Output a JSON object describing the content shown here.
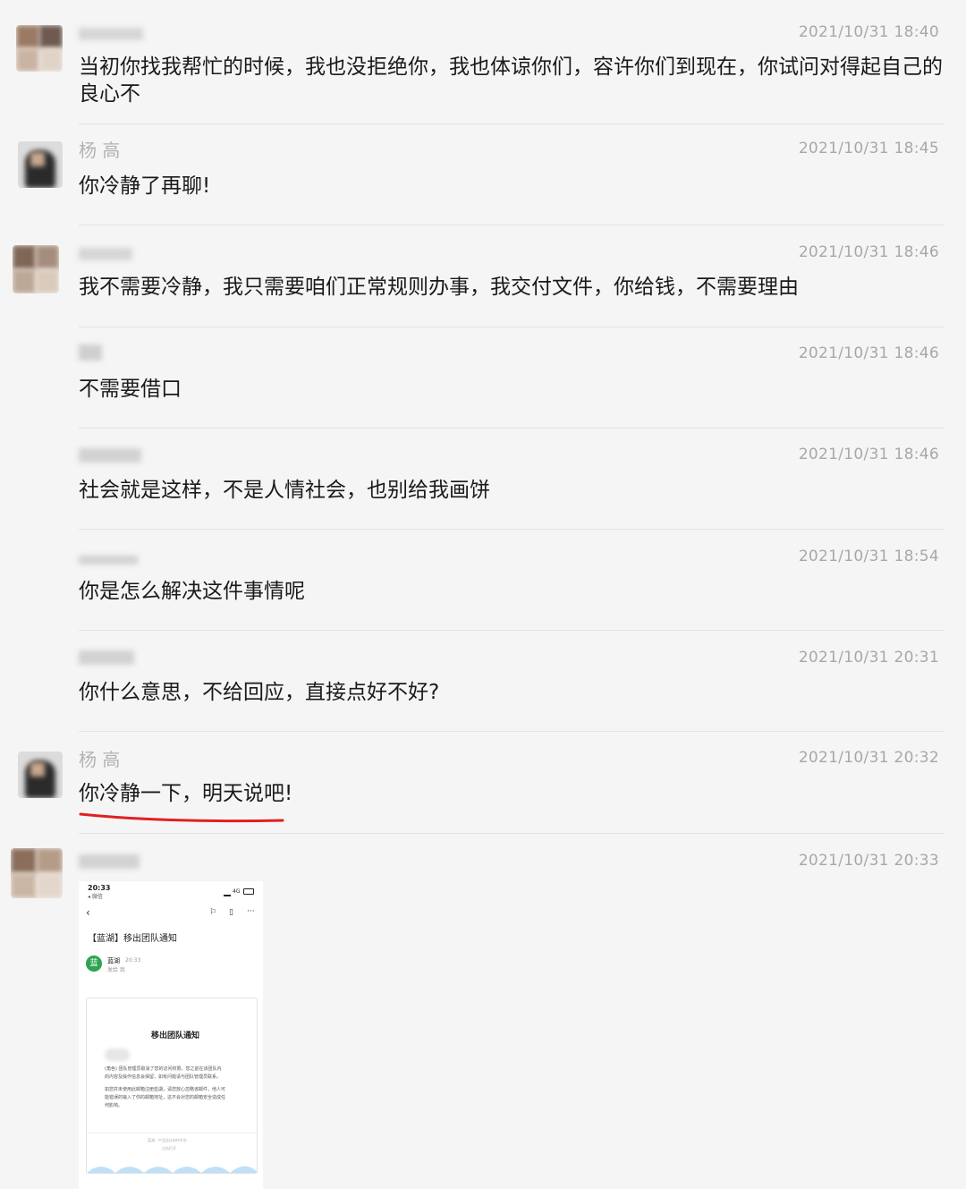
{
  "messages": [
    {
      "name": "",
      "time": "2021/10/31 18:40",
      "text": "当初你找我帮忙的时候，我也没拒绝你，我也体谅你们，容许你们到现在，你试问对得起自己的良心不"
    },
    {
      "name": "杨  高",
      "time": "2021/10/31 18:45",
      "text": "你冷静了再聊!"
    },
    {
      "name": "",
      "time": "2021/10/31 18:46",
      "text": "我不需要冷静，我只需要咱们正常规则办事，我交付文件，你给钱，不需要理由"
    },
    {
      "name": "",
      "time": "2021/10/31 18:46",
      "text": "不需要借口"
    },
    {
      "name": "",
      "time": "2021/10/31 18:46",
      "text": "社会就是这样，不是人情社会，也别给我画饼"
    },
    {
      "name": "",
      "time": "2021/10/31 18:54",
      "text": "你是怎么解决这件事情呢"
    },
    {
      "name": "",
      "time": "2021/10/31 20:31",
      "text": "你什么意思，不给回应，直接点好不好?"
    },
    {
      "name": "杨  高",
      "time": "2021/10/31 20:32",
      "text": "你冷静一下，明天说吧!"
    },
    {
      "name": "",
      "time": "2021/10/31 20:33",
      "text": ""
    }
  ],
  "screenshot": {
    "status_time": "20:33",
    "back_app": "◂ 微信",
    "network": "4G",
    "email_subject": "【蓝湖】移出团队通知",
    "sender_avatar": "蓝",
    "sender": "蓝湖",
    "sender_time": "20:33",
    "recipient": "发给 我",
    "card_title": "移出团队通知",
    "body_line_1": "(角色) 团队管理员取消了您的访问权限。您之前在该团队内",
    "body_line_2": "的内容及操作信息会保留，如有问题请与团队管理员联系。",
    "body_line_3": "如您并未使用此邮箱注册蓝湖，请您放心忽略该邮件，他人可",
    "body_line_4": "能错误的输入了你的邮箱地址，这不会对您的邮箱安全造成任",
    "body_line_5": "何影响。",
    "footer_1": "蓝湖 · 产品设计协作平台",
    "footer_2": "点击打开"
  },
  "colors": {
    "underline": "#e02020",
    "brand_green": "#2ea44f",
    "wave_blue": "#bfe0f7"
  }
}
